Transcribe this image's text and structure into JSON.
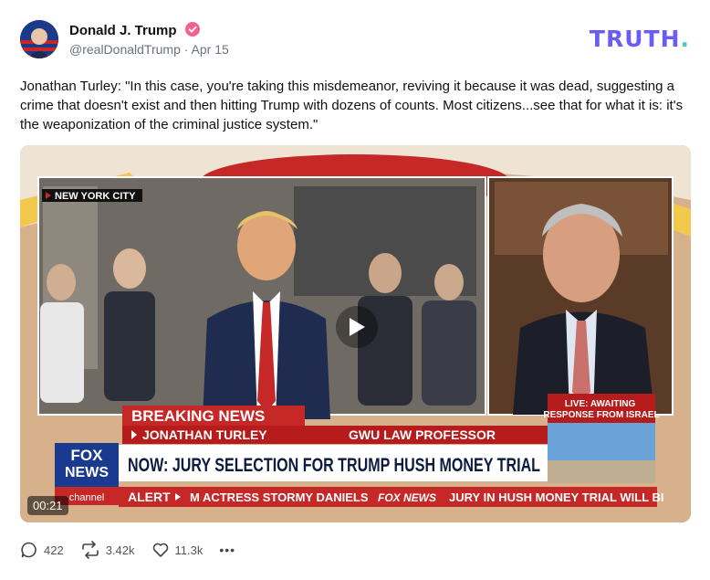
{
  "author": {
    "name": "Donald J. Trump",
    "handle": "@realDonaldTrump",
    "separator": "·",
    "date": "Apr 15",
    "verified_color": "#f06292"
  },
  "brand": {
    "logo_text": "TRUTH",
    "logo_dot": "."
  },
  "post": {
    "text": "Jonathan Turley: \"In this case, you're taking this misdemeanor, reviving it because it was dead, suggesting a crime that doesn't exist and then hitting Trump with dozens of counts. Most citizens...see that for what it is: it's the weaponization of the criminal justice system.\""
  },
  "video": {
    "duration": "00:21",
    "location_tag": "NEW YORK CITY",
    "breaking": "BREAKING NEWS",
    "name_line_name": "JONATHAN TURLEY",
    "name_line_title": "GWU LAW PROFESSOR",
    "headline": "NOW: JURY SELECTION FOR TRUMP HUSH MONEY TRIAL",
    "live_box": "LIVE: AWAITING RESPONSE FROM ISRAEL",
    "alert_label": "ALERT",
    "ticker_1": "M ACTRESS STORMY DANIELS",
    "ticker_brand": "FOX NEWS",
    "ticker_2": "JURY IN HUSH MONEY TRIAL WILL BI",
    "channel_line1": "FOX",
    "channel_line2": "NEWS",
    "channel_line3": "channel"
  },
  "actions": {
    "replies": "422",
    "retruths": "3.42k",
    "likes": "11.3k",
    "more": "•••"
  }
}
